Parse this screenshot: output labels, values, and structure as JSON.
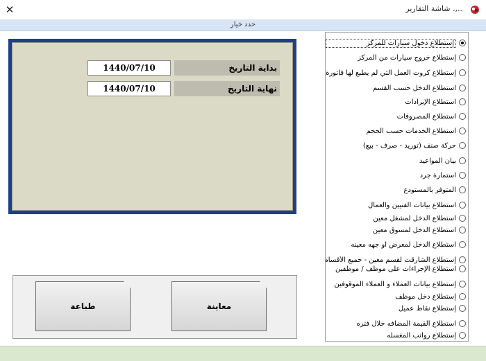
{
  "window": {
    "title": "..,. شاشة التقارير",
    "close_glyph": "✕"
  },
  "header": {
    "label": "حدد خيار"
  },
  "dates": {
    "start_label": "بداية التاريخ",
    "start_value": "1440/07/10",
    "end_label": "نهاية التاريخ",
    "end_value": "1440/07/10"
  },
  "buttons": {
    "preview_label": "معاينة",
    "print_label": "طباعة"
  },
  "options": [
    {
      "label": "إستطلاع دخول سيارات للمركز",
      "selected": true
    },
    {
      "label": "إستطلاع خروج سيارات من المركز",
      "selected": false
    },
    {
      "label": "إستطلاع كروت العمل التي لم يطبع لها فاتورة",
      "selected": false
    },
    {
      "label": "استطلاع الدخل حسب القسم",
      "selected": false
    },
    {
      "label": "استطلاع الإيرادات",
      "selected": false
    },
    {
      "label": "استطلاع المصروفات",
      "selected": false
    },
    {
      "label": "استطلاع الخدمات حسب الحجم",
      "selected": false
    },
    {
      "label": "حركة صنف (توريد - صرف - بيع)",
      "selected": false
    },
    {
      "label": "بيان المواعيد",
      "selected": false
    },
    {
      "label": "استمارة جرد",
      "selected": false
    },
    {
      "label": "المتوفر بالمستودع",
      "selected": false
    },
    {
      "label": "استطلاع بيانات الفنيين والعمال",
      "selected": false
    },
    {
      "label": "استطلاع الدخل لمشغل معين",
      "selected": false
    },
    {
      "label": "استطلاع الدخل لمسوق معين",
      "selected": false
    },
    {
      "label": "استطلاع الدخل لمعرض او جهه معينه",
      "selected": false
    },
    {
      "label": "إستطلاع الشارقت لقسم معين - جميع الأقسام",
      "selected": false
    },
    {
      "label": "استطلاع الإجراءات على موظف / موظفين",
      "selected": false
    },
    {
      "label": "إستطلاع بيانات العملاء و العملاء الموقوفين",
      "selected": false
    },
    {
      "label": "إستطلاع دخل موظف",
      "selected": false
    },
    {
      "label": "إستطلاع نقاط عميل",
      "selected": false
    },
    {
      "label": "استطلاع القيمة المضافه خلال فتره",
      "selected": false
    },
    {
      "label": "إستطلاع رواتب المغسله",
      "selected": false
    }
  ],
  "colors": {
    "panel_border": "#1f3f86",
    "panel_fill": "#dbdac6",
    "header_strip": "#d7e5f5",
    "footer_strip": "#d9e8cf"
  }
}
